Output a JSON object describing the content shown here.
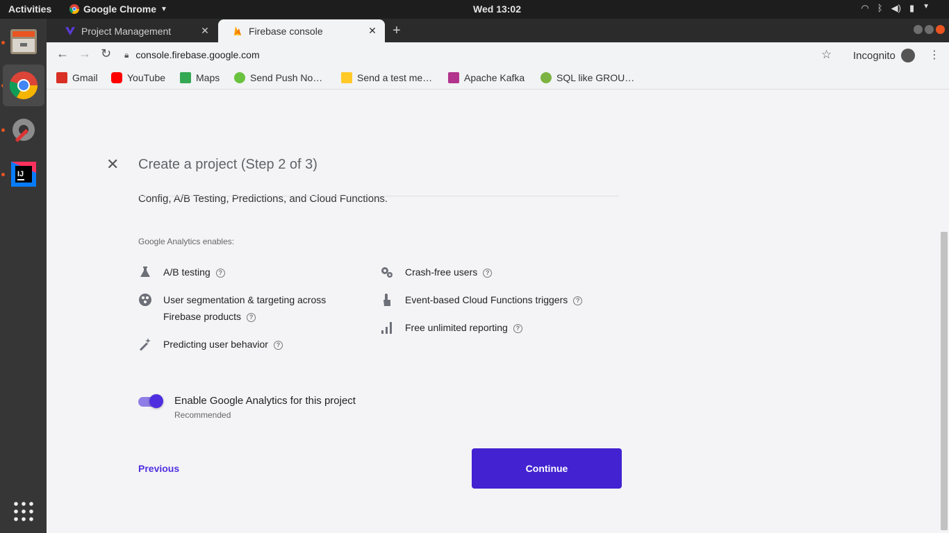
{
  "topbar": {
    "activities": "Activities",
    "app_name": "Google Chrome",
    "clock": "Wed 13:02"
  },
  "tabs": [
    {
      "title": "Project Management"
    },
    {
      "title": "Firebase console"
    }
  ],
  "toolbar": {
    "url": "console.firebase.google.com",
    "incognito": "Incognito"
  },
  "bookmarks": [
    {
      "label": "Gmail",
      "color": "#d93025"
    },
    {
      "label": "YouTube",
      "color": "#ff0000"
    },
    {
      "label": "Maps",
      "color": "#34a853"
    },
    {
      "label": "Send Push No…",
      "color": "#6ac23f"
    },
    {
      "label": "Send a test me…",
      "color": "#ffca28"
    },
    {
      "label": "Apache Kafka",
      "color": "#b3348c"
    },
    {
      "label": "SQL like GROU…",
      "color": "#7cb342"
    }
  ],
  "dialog": {
    "title": "Create a project (Step 2 of 3)",
    "cut_text": "Config, A/B Testing, Predictions, and Cloud Functions.",
    "enables_label": "Google Analytics enables:",
    "features_left": [
      {
        "label": "A/B testing",
        "icon": "flask-icon"
      },
      {
        "label": "User segmentation & targeting across",
        "label2": "Firebase products",
        "icon": "segments-icon"
      },
      {
        "label": "Predicting user behavior",
        "icon": "magic-wand-icon"
      }
    ],
    "features_right": [
      {
        "label": "Crash-free users",
        "icon": "gears-icon"
      },
      {
        "label": "Event-based Cloud Functions triggers",
        "icon": "touch-icon"
      },
      {
        "label": "Free unlimited reporting",
        "icon": "bar-chart-icon"
      }
    ],
    "toggle_label": "Enable Google Analytics for this project",
    "toggle_sub": "Recommended",
    "toggle_on": true,
    "previous": "Previous",
    "continue": "Continue",
    "accent": "#4322d1"
  }
}
